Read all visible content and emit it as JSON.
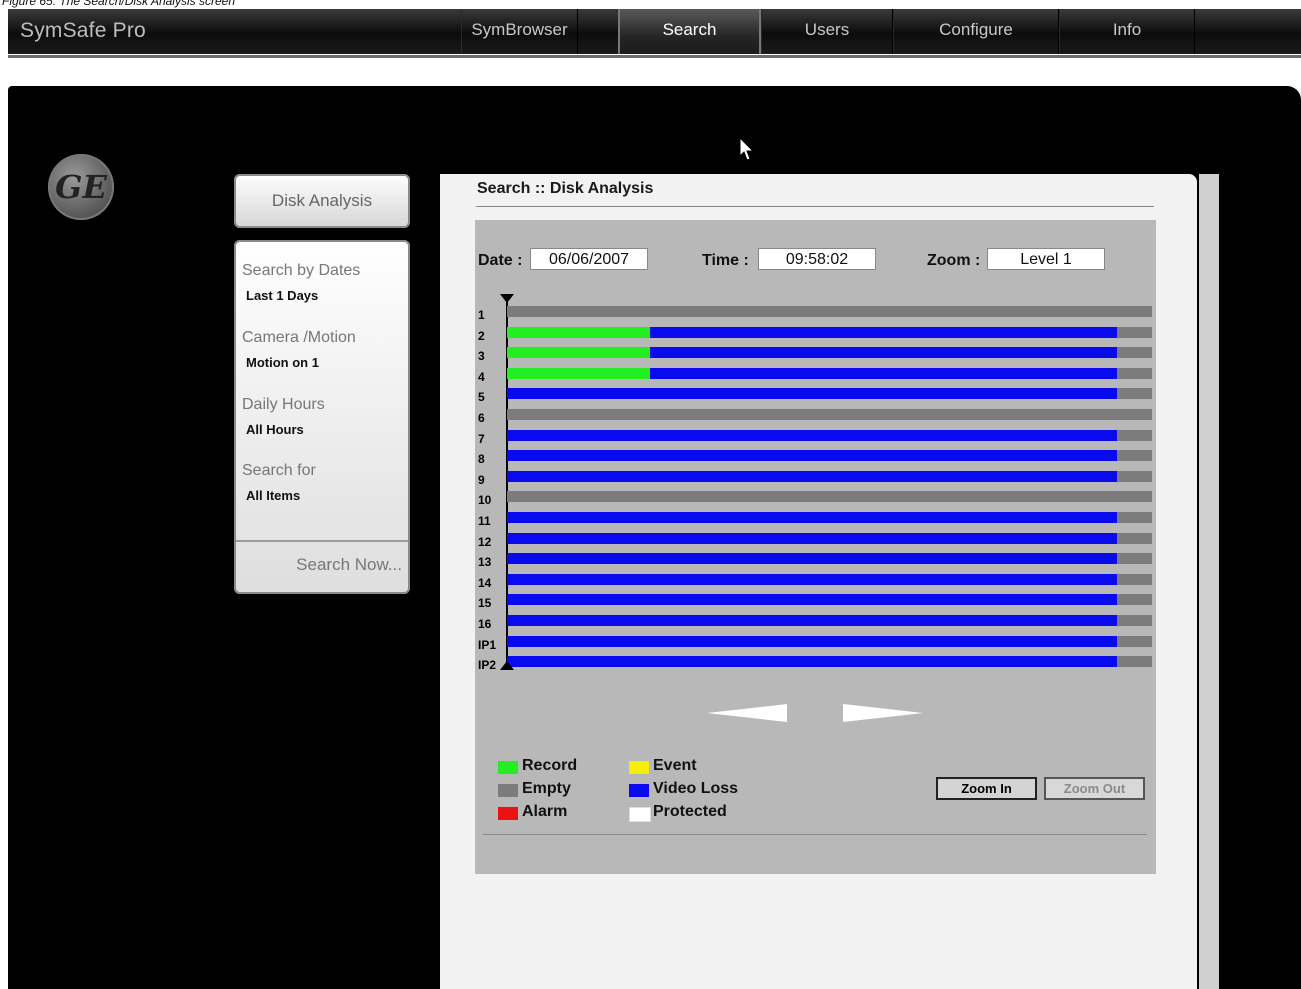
{
  "caption": "Figure 65. The Search/Disk Analysis screen",
  "app": {
    "brand": "SymSafe Pro"
  },
  "nav": {
    "tabs": [
      {
        "label": "SymBrowser"
      },
      {
        "label": "Search"
      },
      {
        "label": "Users"
      },
      {
        "label": "Configure"
      },
      {
        "label": "Info"
      }
    ],
    "active": "Search"
  },
  "logo": {
    "text": "GE"
  },
  "sidebar": {
    "title": "Disk Analysis",
    "groups": [
      {
        "label": "Search by Dates",
        "value": "Last 1 Days"
      },
      {
        "label": "Camera /Motion",
        "value": "Motion on 1"
      },
      {
        "label": "Daily Hours",
        "value": "All Hours"
      },
      {
        "label": "Search for",
        "value": "All Items"
      }
    ],
    "search_now": "Search Now..."
  },
  "content": {
    "title": "Search :: Disk Analysis",
    "date_label": "Date :",
    "date_value": "06/06/2007",
    "time_label": "Time :",
    "time_value": "09:58:02",
    "zoom_label": "Zoom :",
    "zoom_value": "Level 1"
  },
  "timeline": {
    "channels": [
      {
        "label": "1",
        "segments": [
          [
            "empty",
            0,
            1
          ]
        ]
      },
      {
        "label": "2",
        "segments": [
          [
            "record",
            0,
            0.222
          ],
          [
            "videoloss",
            0.222,
            0.945
          ],
          [
            "empty",
            0.945,
            1
          ]
        ]
      },
      {
        "label": "3",
        "segments": [
          [
            "record",
            0,
            0.222
          ],
          [
            "videoloss",
            0.222,
            0.945
          ],
          [
            "empty",
            0.945,
            1
          ]
        ]
      },
      {
        "label": "4",
        "segments": [
          [
            "record",
            0,
            0.222
          ],
          [
            "videoloss",
            0.222,
            0.945
          ],
          [
            "empty",
            0.945,
            1
          ]
        ]
      },
      {
        "label": "5",
        "segments": [
          [
            "videoloss",
            0,
            0.945
          ],
          [
            "empty",
            0.945,
            1
          ]
        ]
      },
      {
        "label": "6",
        "segments": [
          [
            "empty",
            0,
            1
          ]
        ]
      },
      {
        "label": "7",
        "segments": [
          [
            "videoloss",
            0,
            0.945
          ],
          [
            "empty",
            0.945,
            1
          ]
        ]
      },
      {
        "label": "8",
        "segments": [
          [
            "videoloss",
            0,
            0.945
          ],
          [
            "empty",
            0.945,
            1
          ]
        ]
      },
      {
        "label": "9",
        "segments": [
          [
            "videoloss",
            0,
            0.945
          ],
          [
            "empty",
            0.945,
            1
          ]
        ]
      },
      {
        "label": "10",
        "segments": [
          [
            "empty",
            0,
            1
          ]
        ]
      },
      {
        "label": "11",
        "segments": [
          [
            "videoloss",
            0,
            0.945
          ],
          [
            "empty",
            0.945,
            1
          ]
        ]
      },
      {
        "label": "12",
        "segments": [
          [
            "videoloss",
            0,
            0.945
          ],
          [
            "empty",
            0.945,
            1
          ]
        ]
      },
      {
        "label": "13",
        "segments": [
          [
            "videoloss",
            0,
            0.945
          ],
          [
            "empty",
            0.945,
            1
          ]
        ]
      },
      {
        "label": "14",
        "segments": [
          [
            "videoloss",
            0,
            0.945
          ],
          [
            "empty",
            0.945,
            1
          ]
        ]
      },
      {
        "label": "15",
        "segments": [
          [
            "videoloss",
            0,
            0.945
          ],
          [
            "empty",
            0.945,
            1
          ]
        ]
      },
      {
        "label": "16",
        "segments": [
          [
            "videoloss",
            0,
            0.945
          ],
          [
            "empty",
            0.945,
            1
          ]
        ]
      },
      {
        "label": "IP1",
        "segments": [
          [
            "videoloss",
            0,
            0.945
          ],
          [
            "empty",
            0.945,
            1
          ]
        ]
      },
      {
        "label": "IP2",
        "segments": [
          [
            "videoloss",
            0,
            0.945
          ],
          [
            "empty",
            0.945,
            1
          ]
        ]
      }
    ]
  },
  "legend": {
    "items": [
      {
        "key": "record",
        "label": "Record",
        "color": "#22ee22"
      },
      {
        "key": "empty",
        "label": "Empty",
        "color": "#7c7c7c"
      },
      {
        "key": "alarm",
        "label": "Alarm",
        "color": "#ee1111"
      },
      {
        "key": "event",
        "label": "Event",
        "color": "#f2f200"
      },
      {
        "key": "videoloss",
        "label": "Video Loss",
        "color": "#0a0aee"
      },
      {
        "key": "protected",
        "label": "Protected",
        "color": "#ffffff"
      }
    ]
  },
  "buttons": {
    "zoom_in": "Zoom In",
    "zoom_out": "Zoom Out"
  }
}
